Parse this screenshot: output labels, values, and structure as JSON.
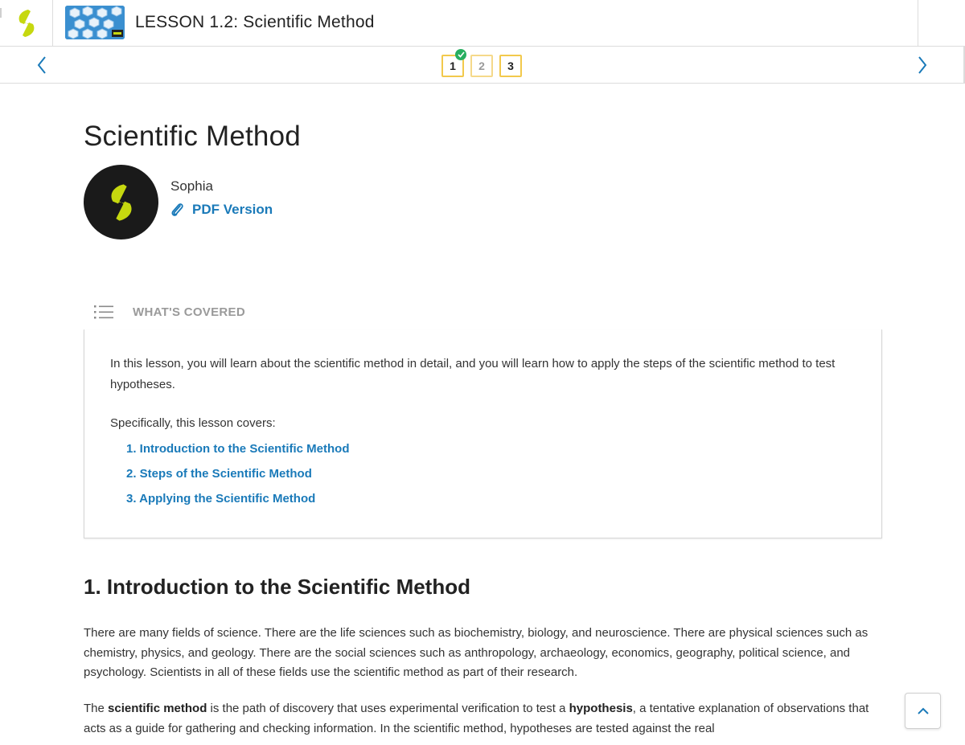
{
  "header": {
    "lesson_title": "LESSON 1.2: Scientific Method",
    "brand_color": "#c6d80f",
    "thumbnail_icon": "molecule-thumbnail"
  },
  "step_nav": {
    "steps": [
      {
        "label": "1",
        "completed": true
      },
      {
        "label": "2",
        "completed": false
      },
      {
        "label": "3",
        "completed": false
      }
    ],
    "prev_icon": "chevron-left-icon",
    "next_icon": "chevron-right-icon"
  },
  "article": {
    "title": "Scientific Method",
    "author": "Sophia",
    "pdf_label": "PDF Version"
  },
  "covered": {
    "heading": "WHAT'S COVERED",
    "intro": "In this lesson, you will learn about the scientific method in detail, and you will learn how to apply the steps of the scientific method to test hypotheses.",
    "specifically": "Specifically, this lesson covers:",
    "items": [
      "1. Introduction to the Scientific Method",
      "2. Steps of the Scientific Method",
      "3. Applying the Scientific Method"
    ]
  },
  "section1": {
    "title": "1. Introduction to the Scientific Method",
    "para1": "There are many fields of science. There are the life sciences such as biochemistry, biology, and neuroscience. There are physical sciences such as chemistry, physics, and geology. There are the social sciences such as anthropology, archaeology, economics, geography, political science, and psychology. Scientists in all of these fields use the scientific method as part of their research.",
    "para2_a": "The ",
    "para2_term1": "scientific method",
    "para2_b": " is the path of discovery that uses experimental verification to test a ",
    "para2_term2": "hypothesis",
    "para2_c": ", a tentative explanation of observations that acts as a guide for gathering and checking information. In the scientific method, hypotheses are tested against the real"
  },
  "colors": {
    "link_blue": "#1a7ab9",
    "step_border": "#f2c94c",
    "check_green": "#27ae60"
  }
}
